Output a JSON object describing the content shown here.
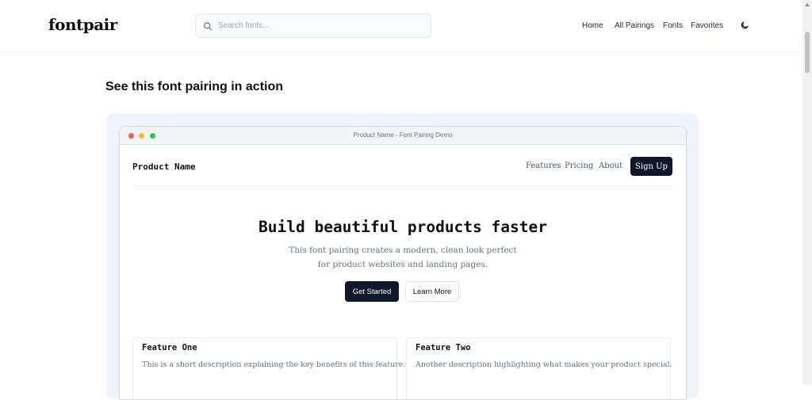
{
  "header": {
    "logo": "fontpair",
    "search": {
      "placeholder": "Search fonts...",
      "value": ""
    },
    "nav": [
      "Home",
      "All Pairings",
      "Fonts",
      "Favorites"
    ],
    "theme_toggle_icon": "moon-icon"
  },
  "section": {
    "title": "See this font pairing in action"
  },
  "demo": {
    "window_title": "Product Name - Font Pairing Demo",
    "brand": "Product Name",
    "nav": [
      "Features",
      "Pricing",
      "About"
    ],
    "signup_label": "Sign Up",
    "hero": {
      "title": "Build beautiful products faster",
      "description": "This font pairing creates a modern, clean look perfect for product websites and landing pages.",
      "primary_button": "Get Started",
      "secondary_button": "Learn More"
    },
    "features": [
      {
        "title": "Feature One",
        "description": "This is a short description explaining the key benefits of this feature."
      },
      {
        "title": "Feature Two",
        "description": "Another description highlighting what makes your product special."
      }
    ]
  },
  "colors": {
    "primary_dark": "#0f172a",
    "demo_background": "#eef4fd",
    "dot_red": "#ef5f57",
    "dot_yellow": "#f5bd2f",
    "dot_green": "#2ac941"
  }
}
